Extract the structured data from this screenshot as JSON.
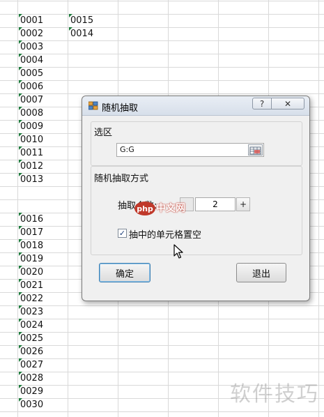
{
  "sheet": {
    "column_a": [
      "0001",
      "0002",
      "0003",
      "0004",
      "0005",
      "0006",
      "0007",
      "0008",
      "0009",
      "0010",
      "0011",
      "0012",
      "0013",
      "",
      "",
      "0016",
      "0017",
      "0018",
      "0019",
      "0020",
      "0021",
      "0022",
      "0023",
      "0024",
      "0025",
      "0026",
      "0027",
      "0028",
      "0029",
      "0030"
    ],
    "column_b": [
      "0015",
      "0014"
    ]
  },
  "dialog": {
    "title": "随机抽取",
    "help_glyph": "?",
    "close_glyph": "✕",
    "range_section": "选区",
    "range_value": "G:G",
    "method_section": "随机抽取方式",
    "count_label": "抽取个数:",
    "count_value": "2",
    "plus_label": "+",
    "clear_checked": true,
    "clear_label": "抽中的单元格置空",
    "ok_label": "确定",
    "exit_label": "退出"
  },
  "overlay": {
    "site_logo": "php",
    "site_text": "中文网",
    "watermark": "软件技巧"
  },
  "colors": {
    "grid": "#d9d9d9",
    "cell_marker": "#1e7a3c",
    "dialog_bg": "#f0f0f0",
    "php_logo_red": "#c0392b"
  }
}
